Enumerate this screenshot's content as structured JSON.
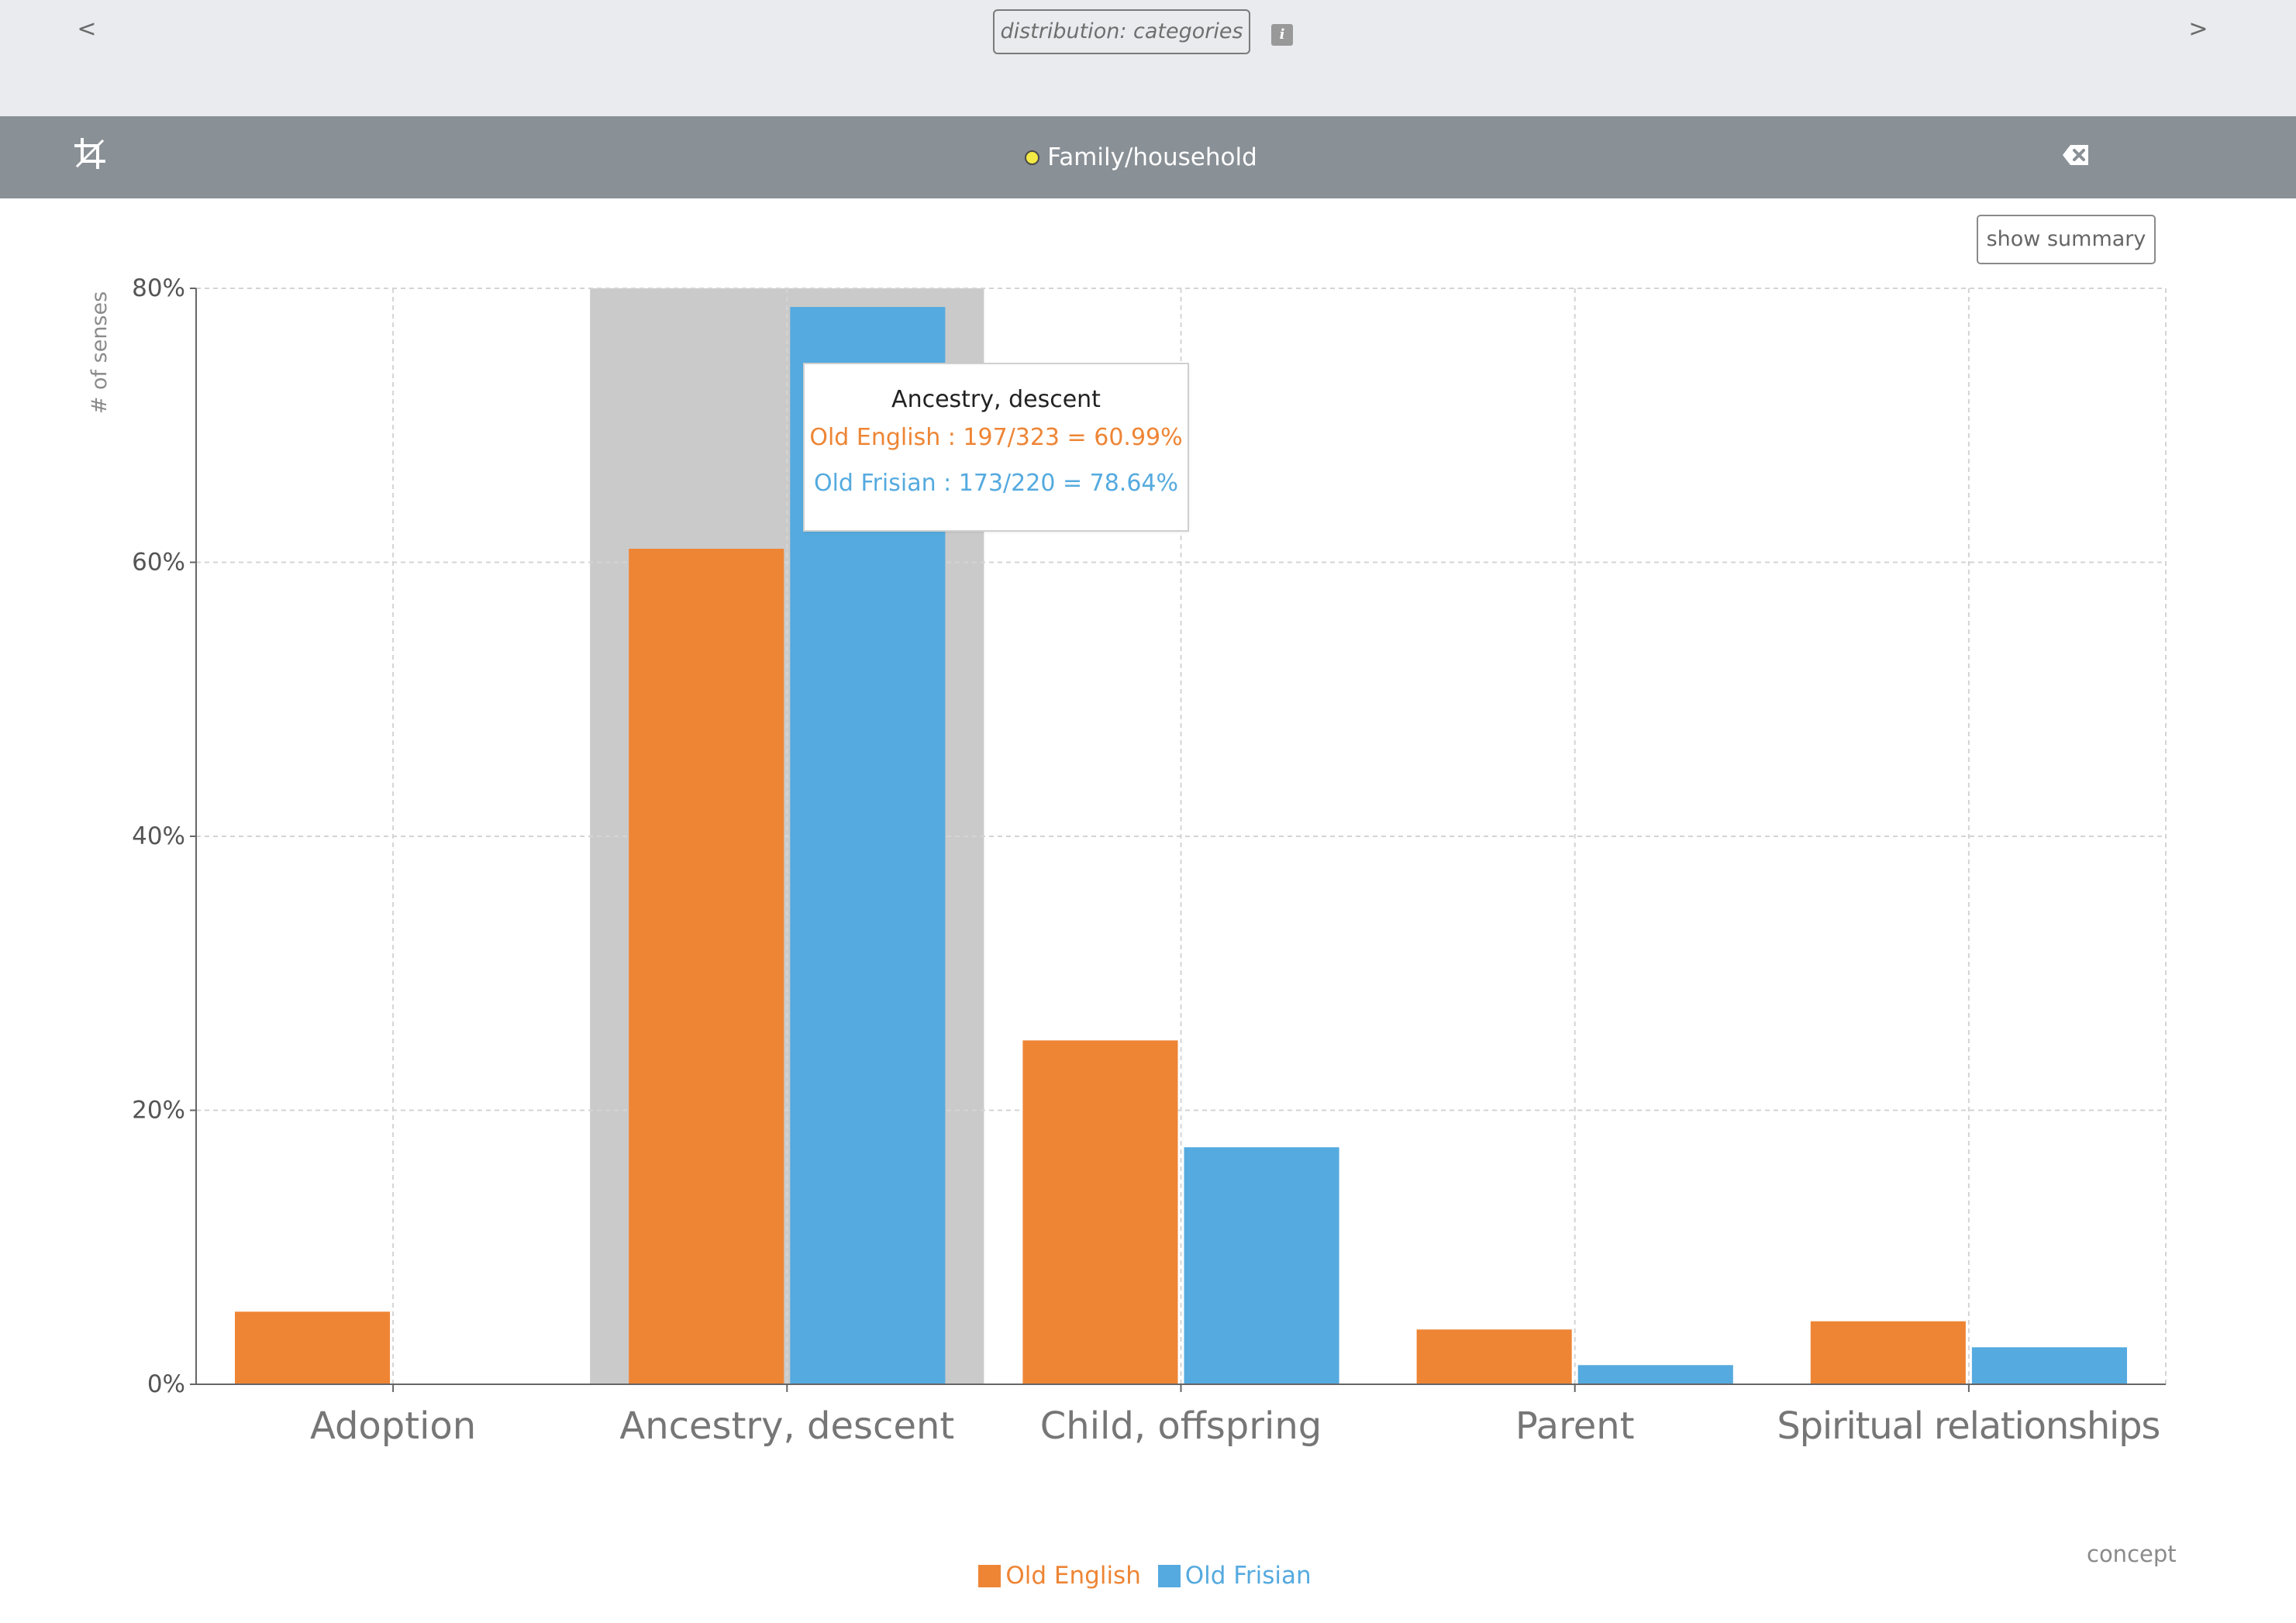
{
  "nav": {
    "prev": "<",
    "next": ">"
  },
  "header": {
    "distribution_label": "distribution: categories",
    "info_icon": "i",
    "title": "Family/household",
    "title_dot_color": "#f4ea45",
    "crop_icon": "crop-icon",
    "clear_icon": "backspace-icon"
  },
  "summary_button": "show summary",
  "x_axis_name": "concept",
  "colors": {
    "old_english": "#ee8535",
    "old_frisian": "#55aadf",
    "highlight": "#cacaca"
  },
  "chart_data": {
    "type": "bar",
    "ylabel": "# of senses",
    "xlabel": "concept",
    "ylim": [
      0,
      80
    ],
    "yticks": [
      "0%",
      "20%",
      "40%",
      "60%",
      "80%"
    ],
    "grid": true,
    "legend_position": "bottom",
    "categories": [
      "Adoption",
      "Ancestry, descent",
      "Child, offspring",
      "Parent",
      "Spiritual relationships"
    ],
    "series": [
      {
        "name": "Old English",
        "values": [
          5.3,
          60.99,
          25.1,
          4.0,
          4.6
        ]
      },
      {
        "name": "Old Frisian",
        "values": [
          0,
          78.64,
          17.3,
          1.4,
          2.7
        ]
      }
    ],
    "highlighted_category": "Ancestry, descent"
  },
  "tooltip": {
    "title": "Ancestry, descent",
    "rows": [
      {
        "text": "Old English : 197/323 = 60.99%"
      },
      {
        "text": "Old Frisian : 173/220 = 78.64%"
      }
    ]
  }
}
